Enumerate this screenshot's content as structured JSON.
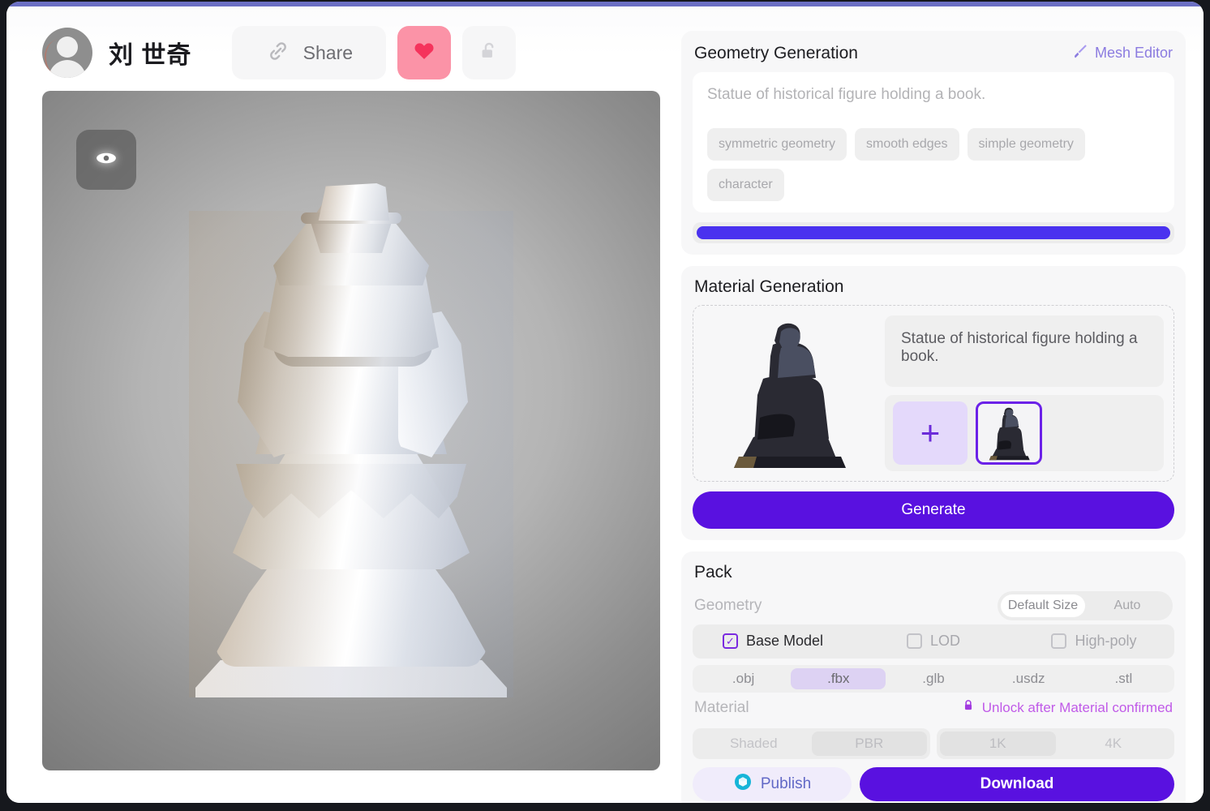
{
  "header": {
    "user_name": "刘 世奇",
    "share_label": "Share",
    "avatar_icon": "user-avatar-icon",
    "link_icon": "link-icon",
    "like_icon": "heart-icon",
    "lock_icon": "unlocked-padlock-icon",
    "accent": "#5911e0",
    "like_bg": "#fb93a7",
    "like_fill": "#f5335c"
  },
  "viewport": {
    "eye_icon": "eye-icon",
    "model_description": "Low-poly white statue of a robed figure holding a book, on a square plinth"
  },
  "geometry": {
    "title": "Geometry Generation",
    "mesh_editor_label": "Mesh Editor",
    "mesh_editor_icon": "paintbrush-icon",
    "prompt_placeholder": "Statue of historical figure holding a book.",
    "prompt_value": "",
    "chips": [
      "symmetric geometry",
      "smooth edges",
      "simple geometry",
      "character"
    ],
    "progress_percent": 100,
    "progress_color": "#4a32ef"
  },
  "material": {
    "title": "Material Generation",
    "prompt_value": "Statue of historical figure holding a book.",
    "add_reference_icon": "plus-icon",
    "reference_selected": true,
    "preview_alt": "dark bronze statue reference",
    "generate_label": "Generate"
  },
  "pack": {
    "title": "Pack",
    "geometry_label": "Geometry",
    "size_toggle": {
      "options": [
        "Default Size",
        "Auto"
      ],
      "selected": "Default Size"
    },
    "model_options": [
      {
        "label": "Base Model",
        "checked": true
      },
      {
        "label": "LOD",
        "checked": false
      },
      {
        "label": "High-poly",
        "checked": false
      }
    ],
    "formats": {
      "options": [
        ".obj",
        ".fbx",
        ".glb",
        ".usdz",
        ".stl"
      ],
      "selected": ".fbx"
    },
    "material_label": "Material",
    "unlock_note": "Unlock after Material confirmed",
    "unlock_icon": "padlock-icon",
    "unlock_color": "#c05ae8",
    "shading": {
      "options": [
        "Shaded",
        "PBR"
      ],
      "selected": "PBR",
      "disabled": true
    },
    "resolution": {
      "options": [
        "1K",
        "4K"
      ],
      "selected": "1K",
      "disabled": true
    },
    "publish_label": "Publish",
    "publish_icon": "cube-badge-icon",
    "download_label": "Download"
  }
}
